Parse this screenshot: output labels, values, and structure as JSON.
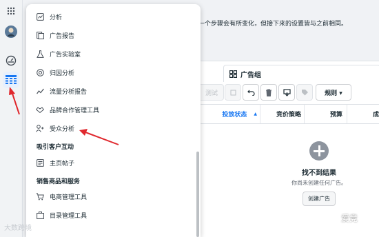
{
  "notice": {
    "text": "一个步骤会有所变化，但接下来的设置皆与之前相同。"
  },
  "adgroup_tab": {
    "label": "广告组"
  },
  "toolbar": {
    "test_label": "测试",
    "rules_label": "规则 ▾"
  },
  "table": {
    "columns": [
      "投放状态",
      "竞价策略",
      "预算",
      "成"
    ]
  },
  "empty_state": {
    "title": "找不到结果",
    "subtitle": "你尚未创建任何广告。",
    "create_label": "创建广告"
  },
  "menu": {
    "items_top": [
      {
        "icon": "chart-icon",
        "label": "分析"
      },
      {
        "icon": "report-icon",
        "label": "广告报告"
      },
      {
        "icon": "flask-icon",
        "label": "广告实验室"
      },
      {
        "icon": "attribution-icon",
        "label": "归因分析"
      },
      {
        "icon": "trend-icon",
        "label": "流量分析报告"
      },
      {
        "icon": "handshake-icon",
        "label": "品牌合作管理工具"
      },
      {
        "icon": "audience-icon",
        "label": "受众分析"
      }
    ],
    "section_engage": "吸引客户互动",
    "item_page_posts": {
      "icon": "page-icon",
      "label": "主页帖子"
    },
    "section_commerce": "销售商品和服务",
    "item_commerce_manager": {
      "icon": "cart-icon",
      "label": "电商管理工具"
    },
    "item_catalog_manager": {
      "icon": "catalog-icon",
      "label": "目录管理工具"
    }
  },
  "watermark": {
    "text": "大数跨境"
  },
  "wechat": {
    "text": "爱竞"
  },
  "colors": {
    "arrow": "#e0282e",
    "accent": "#1877f2"
  }
}
